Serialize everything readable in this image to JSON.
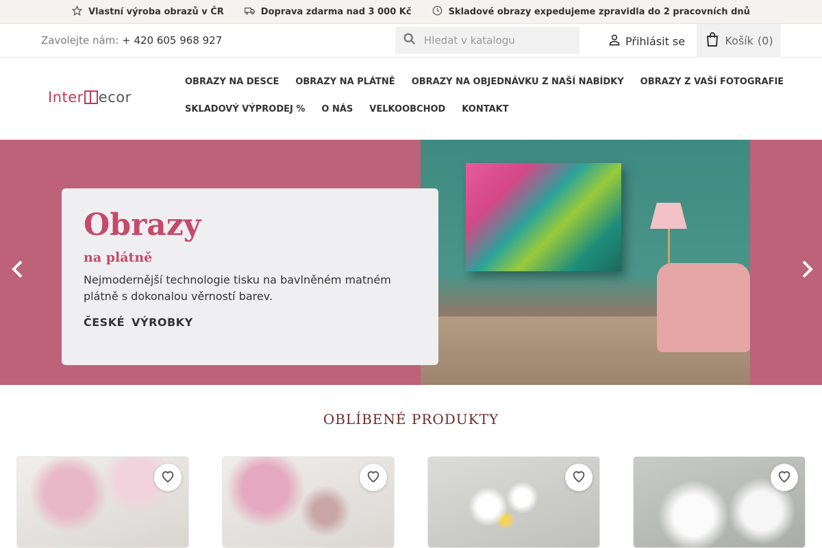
{
  "topbar": {
    "items": [
      {
        "icon": "star-icon",
        "text": "Vlastní výroba obrazů v ČR"
      },
      {
        "icon": "truck-icon",
        "text": "Doprava zdarma nad 3 000 Kč"
      },
      {
        "icon": "clock-icon",
        "text": "Skladové obrazy expedujeme zpravidla do 2 pracovních dnů"
      }
    ]
  },
  "header": {
    "phone_label": "Zavolejte nám:",
    "phone_number": "+ 420 605 968 927",
    "search_placeholder": "Hledat v katalogu",
    "login_label": "Přihlásit se",
    "cart_label": "Košík",
    "cart_count": "(0)"
  },
  "logo": {
    "part1": "Inter",
    "part2": "ecor",
    "accent_color": "#c0395a"
  },
  "menu": {
    "row1": [
      "OBRAZY NA DESCE",
      "OBRAZY NA PLÁTNĚ",
      "OBRAZY NA OBJEDNÁVKU Z NAŠÍ NABÍDKY",
      "OBRAZY Z VAŠÍ FOTOGRAFIE"
    ],
    "row2": [
      "SKLADOVÝ VÝPRODEJ %",
      "O NÁS",
      "VELKOOBCHOD",
      "KONTAKT"
    ]
  },
  "hero": {
    "title": "Obrazy",
    "subtitle": "na plátně",
    "text": "Nejmodernější technologie tisku na bavlněném matném plátně s dokonalou věrností barev.",
    "cta": "ČESKÉ VÝROBKY",
    "background_color": "#bd6279"
  },
  "products": {
    "title": "OBLÍBENÉ PRODUKTY"
  }
}
